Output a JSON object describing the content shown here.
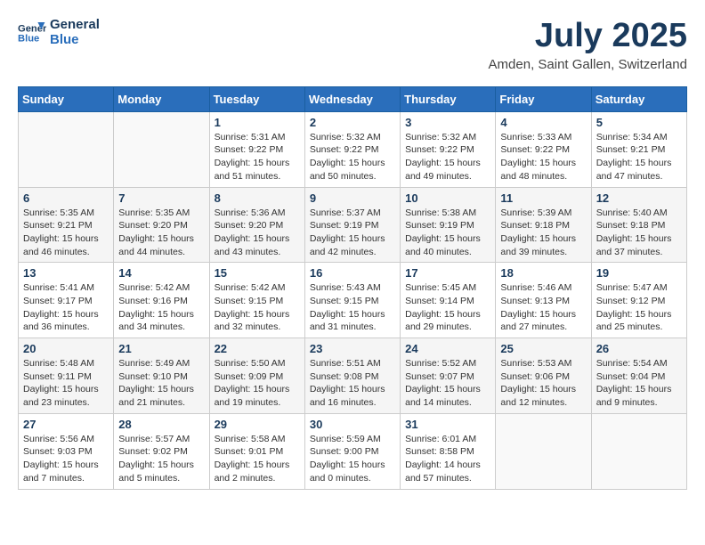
{
  "header": {
    "logo_line1": "General",
    "logo_line2": "Blue",
    "month_year": "July 2025",
    "location": "Amden, Saint Gallen, Switzerland"
  },
  "weekdays": [
    "Sunday",
    "Monday",
    "Tuesday",
    "Wednesday",
    "Thursday",
    "Friday",
    "Saturday"
  ],
  "weeks": [
    [
      {
        "day": "",
        "sunrise": "",
        "sunset": "",
        "daylight": ""
      },
      {
        "day": "",
        "sunrise": "",
        "sunset": "",
        "daylight": ""
      },
      {
        "day": "1",
        "sunrise": "Sunrise: 5:31 AM",
        "sunset": "Sunset: 9:22 PM",
        "daylight": "Daylight: 15 hours and 51 minutes."
      },
      {
        "day": "2",
        "sunrise": "Sunrise: 5:32 AM",
        "sunset": "Sunset: 9:22 PM",
        "daylight": "Daylight: 15 hours and 50 minutes."
      },
      {
        "day": "3",
        "sunrise": "Sunrise: 5:32 AM",
        "sunset": "Sunset: 9:22 PM",
        "daylight": "Daylight: 15 hours and 49 minutes."
      },
      {
        "day": "4",
        "sunrise": "Sunrise: 5:33 AM",
        "sunset": "Sunset: 9:22 PM",
        "daylight": "Daylight: 15 hours and 48 minutes."
      },
      {
        "day": "5",
        "sunrise": "Sunrise: 5:34 AM",
        "sunset": "Sunset: 9:21 PM",
        "daylight": "Daylight: 15 hours and 47 minutes."
      }
    ],
    [
      {
        "day": "6",
        "sunrise": "Sunrise: 5:35 AM",
        "sunset": "Sunset: 9:21 PM",
        "daylight": "Daylight: 15 hours and 46 minutes."
      },
      {
        "day": "7",
        "sunrise": "Sunrise: 5:35 AM",
        "sunset": "Sunset: 9:20 PM",
        "daylight": "Daylight: 15 hours and 44 minutes."
      },
      {
        "day": "8",
        "sunrise": "Sunrise: 5:36 AM",
        "sunset": "Sunset: 9:20 PM",
        "daylight": "Daylight: 15 hours and 43 minutes."
      },
      {
        "day": "9",
        "sunrise": "Sunrise: 5:37 AM",
        "sunset": "Sunset: 9:19 PM",
        "daylight": "Daylight: 15 hours and 42 minutes."
      },
      {
        "day": "10",
        "sunrise": "Sunrise: 5:38 AM",
        "sunset": "Sunset: 9:19 PM",
        "daylight": "Daylight: 15 hours and 40 minutes."
      },
      {
        "day": "11",
        "sunrise": "Sunrise: 5:39 AM",
        "sunset": "Sunset: 9:18 PM",
        "daylight": "Daylight: 15 hours and 39 minutes."
      },
      {
        "day": "12",
        "sunrise": "Sunrise: 5:40 AM",
        "sunset": "Sunset: 9:18 PM",
        "daylight": "Daylight: 15 hours and 37 minutes."
      }
    ],
    [
      {
        "day": "13",
        "sunrise": "Sunrise: 5:41 AM",
        "sunset": "Sunset: 9:17 PM",
        "daylight": "Daylight: 15 hours and 36 minutes."
      },
      {
        "day": "14",
        "sunrise": "Sunrise: 5:42 AM",
        "sunset": "Sunset: 9:16 PM",
        "daylight": "Daylight: 15 hours and 34 minutes."
      },
      {
        "day": "15",
        "sunrise": "Sunrise: 5:42 AM",
        "sunset": "Sunset: 9:15 PM",
        "daylight": "Daylight: 15 hours and 32 minutes."
      },
      {
        "day": "16",
        "sunrise": "Sunrise: 5:43 AM",
        "sunset": "Sunset: 9:15 PM",
        "daylight": "Daylight: 15 hours and 31 minutes."
      },
      {
        "day": "17",
        "sunrise": "Sunrise: 5:45 AM",
        "sunset": "Sunset: 9:14 PM",
        "daylight": "Daylight: 15 hours and 29 minutes."
      },
      {
        "day": "18",
        "sunrise": "Sunrise: 5:46 AM",
        "sunset": "Sunset: 9:13 PM",
        "daylight": "Daylight: 15 hours and 27 minutes."
      },
      {
        "day": "19",
        "sunrise": "Sunrise: 5:47 AM",
        "sunset": "Sunset: 9:12 PM",
        "daylight": "Daylight: 15 hours and 25 minutes."
      }
    ],
    [
      {
        "day": "20",
        "sunrise": "Sunrise: 5:48 AM",
        "sunset": "Sunset: 9:11 PM",
        "daylight": "Daylight: 15 hours and 23 minutes."
      },
      {
        "day": "21",
        "sunrise": "Sunrise: 5:49 AM",
        "sunset": "Sunset: 9:10 PM",
        "daylight": "Daylight: 15 hours and 21 minutes."
      },
      {
        "day": "22",
        "sunrise": "Sunrise: 5:50 AM",
        "sunset": "Sunset: 9:09 PM",
        "daylight": "Daylight: 15 hours and 19 minutes."
      },
      {
        "day": "23",
        "sunrise": "Sunrise: 5:51 AM",
        "sunset": "Sunset: 9:08 PM",
        "daylight": "Daylight: 15 hours and 16 minutes."
      },
      {
        "day": "24",
        "sunrise": "Sunrise: 5:52 AM",
        "sunset": "Sunset: 9:07 PM",
        "daylight": "Daylight: 15 hours and 14 minutes."
      },
      {
        "day": "25",
        "sunrise": "Sunrise: 5:53 AM",
        "sunset": "Sunset: 9:06 PM",
        "daylight": "Daylight: 15 hours and 12 minutes."
      },
      {
        "day": "26",
        "sunrise": "Sunrise: 5:54 AM",
        "sunset": "Sunset: 9:04 PM",
        "daylight": "Daylight: 15 hours and 9 minutes."
      }
    ],
    [
      {
        "day": "27",
        "sunrise": "Sunrise: 5:56 AM",
        "sunset": "Sunset: 9:03 PM",
        "daylight": "Daylight: 15 hours and 7 minutes."
      },
      {
        "day": "28",
        "sunrise": "Sunrise: 5:57 AM",
        "sunset": "Sunset: 9:02 PM",
        "daylight": "Daylight: 15 hours and 5 minutes."
      },
      {
        "day": "29",
        "sunrise": "Sunrise: 5:58 AM",
        "sunset": "Sunset: 9:01 PM",
        "daylight": "Daylight: 15 hours and 2 minutes."
      },
      {
        "day": "30",
        "sunrise": "Sunrise: 5:59 AM",
        "sunset": "Sunset: 9:00 PM",
        "daylight": "Daylight: 15 hours and 0 minutes."
      },
      {
        "day": "31",
        "sunrise": "Sunrise: 6:01 AM",
        "sunset": "Sunset: 8:58 PM",
        "daylight": "Daylight: 14 hours and 57 minutes."
      },
      {
        "day": "",
        "sunrise": "",
        "sunset": "",
        "daylight": ""
      },
      {
        "day": "",
        "sunrise": "",
        "sunset": "",
        "daylight": ""
      }
    ]
  ]
}
